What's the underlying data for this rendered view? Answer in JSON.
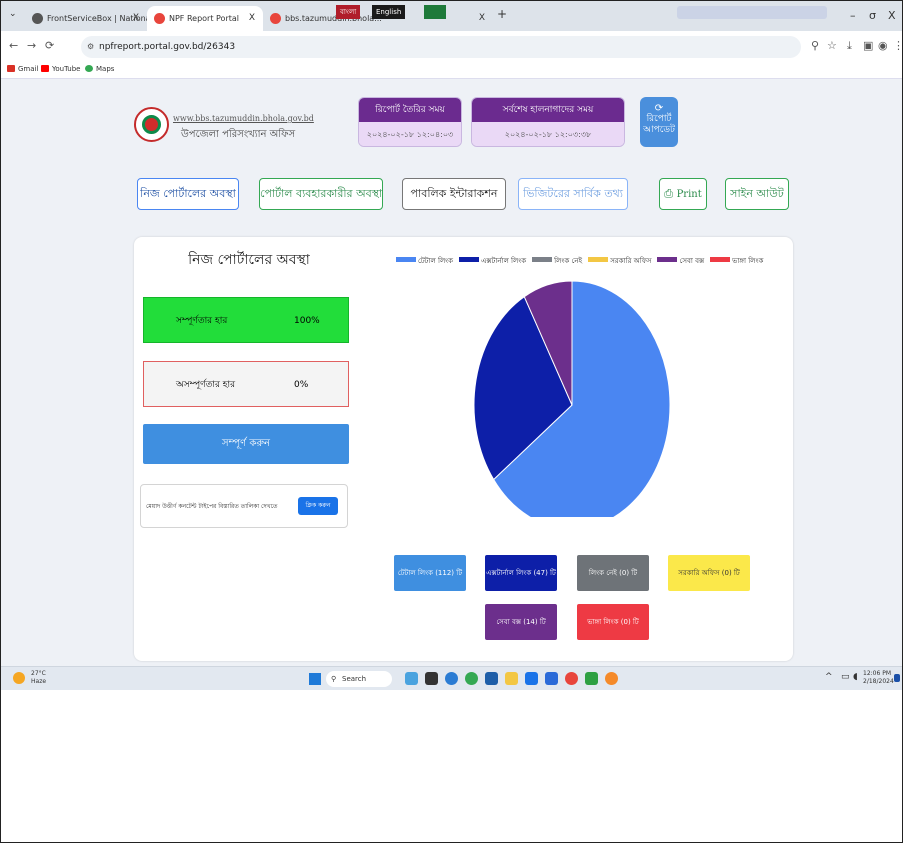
{
  "browser": {
    "tabs": [
      {
        "label": "FrontServiceBox | National Port",
        "close": "X"
      },
      {
        "label": "NPF Report Portal",
        "close": "X"
      },
      {
        "label": "bbs.tazumuddin.bhola...",
        "close": "X"
      }
    ],
    "new_tab": "+",
    "url": "npfreport.portal.gov.bd/26343",
    "bookmarks": [
      "Gmail",
      "YouTube",
      "Maps"
    ],
    "ime_labels": [
      "বাংলা",
      "English"
    ],
    "window_controls": [
      "–",
      "σ",
      "X"
    ]
  },
  "header": {
    "site_url": "www.bbs.tazumuddin.bhola.gov.bd",
    "office_name": "উপজেলা পরিসংখ্যান অফিস",
    "report_time_label": "রিপোর্ট তৈরির সময়",
    "report_time_value": "২০২৪-০২-১৮ ১২:০৪:০৩",
    "last_update_label": "সর্বশেষ হালনাগাদের সময়",
    "last_update_value": "২০২৪-০২-১৮ ১২:০৩:৩৮",
    "update_button_line1": "রিপোর্ট",
    "update_button_line2": "আপডেট"
  },
  "nav": {
    "own_portal_status": "নিজ পোর্টালের অবস্থা",
    "user_status": "পোর্টাল ব্যবহারকারীর অবস্থা",
    "public_interaction": "পাবলিক ইন্টারাকশন",
    "visitor_info": "ভিজিটরের সার্বিক তথ্য",
    "print": "Print",
    "sign_out": "সাইন আউট"
  },
  "panel": {
    "title": "নিজ পোর্টালের অবস্থা",
    "completion_label": "সম্পূর্ণতার হার",
    "completion_value": "100%",
    "incompletion_label": "অসম্পূর্ণতার হার",
    "incompletion_value": "0%",
    "complete_button": "সম্পূর্ণ করুন",
    "detail_text": "মেয়াদ উত্তীর্ণ কনটেন্ট টাইপের বিস্তারিত তালিকা দেখতে",
    "detail_button": "ক্লিক করুন"
  },
  "legend": [
    {
      "label": "টেটাল লিংক",
      "color": "#4a86f2"
    },
    {
      "label": "এক্সটার্নাল লিংক",
      "color": "#0d1fa8"
    },
    {
      "label": "লিংক নেই",
      "color": "#7b8088"
    },
    {
      "label": "সরকারি অফিস",
      "color": "#f3c744"
    },
    {
      "label": "সেবা বক্স",
      "color": "#6c2f8c"
    },
    {
      "label": "ভাঙ্গা লিংক",
      "color": "#ee3a44"
    }
  ],
  "chart_data": {
    "type": "pie",
    "labels": [
      "টেটাল লিংক",
      "এক্সটার্নাল লিংক",
      "লিংক নেই",
      "সরকারি অফিস",
      "সেবা বক্স",
      "ভাঙ্গা লিংক"
    ],
    "values": [
      112,
      47,
      0,
      0,
      14,
      0
    ],
    "colors": [
      "#4a86f2",
      "#0d1fa8",
      "#7b8088",
      "#f3c744",
      "#6c2f8c",
      "#ee3a44"
    ]
  },
  "category_buttons": [
    {
      "label": "টেটাল লিংক (112) টি",
      "bg": "#3f8fe0",
      "fg": "#ffffff"
    },
    {
      "label": "এক্সটার্নাল লিংক (47) টি",
      "bg": "#0d1fa8",
      "fg": "#ffffff"
    },
    {
      "label": "লিংক নেই (0) টি",
      "bg": "#6e7378",
      "fg": "#ffffff"
    },
    {
      "label": "সরকারি অফিস (0) টি",
      "bg": "#fbe84a",
      "fg": "#333333"
    },
    {
      "label": "সেবা বক্স (14) টি",
      "bg": "#6c2f8c",
      "fg": "#ffffff"
    },
    {
      "label": "ভাঙ্গা লিংক (0) টি",
      "bg": "#ee3a44",
      "fg": "#ffffff"
    }
  ],
  "taskbar": {
    "temperature": "27°C",
    "weather": "Haze",
    "search": "Search",
    "time": "12:06 PM",
    "date": "2/18/2024"
  }
}
